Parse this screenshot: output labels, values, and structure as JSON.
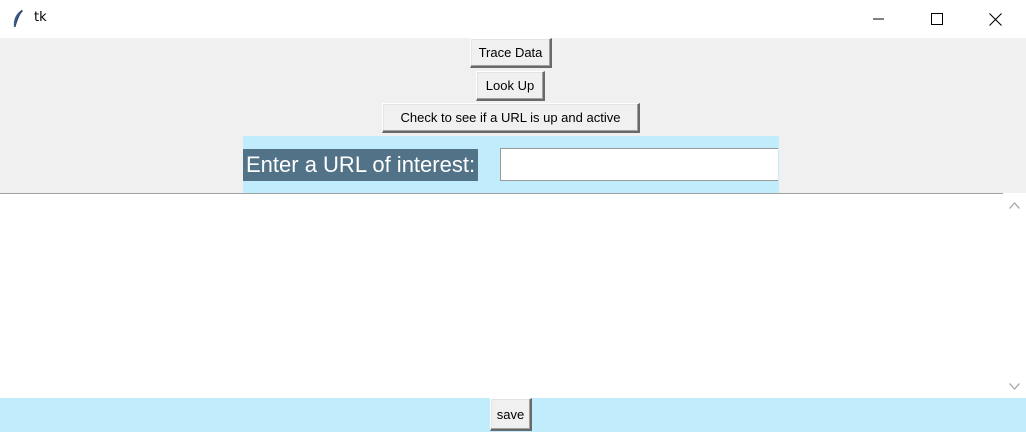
{
  "window": {
    "title": "tk",
    "icon": "feather-icon",
    "controls": [
      "minimize-icon",
      "maximize-icon",
      "close-icon"
    ]
  },
  "buttons": {
    "trace_data": "Trace Data",
    "look_up": "Look Up",
    "check_url": "Check to see if a URL is up and active"
  },
  "url_entry": {
    "label": "Enter a URL of interest:",
    "value": ""
  },
  "output": {
    "text": ""
  },
  "footer": {
    "save": "save"
  },
  "colors": {
    "frame_bg": "#c0ecfb",
    "label_bg": "#517287",
    "label_fg": "#ffffff",
    "window_bg": "#f0f0f0"
  }
}
